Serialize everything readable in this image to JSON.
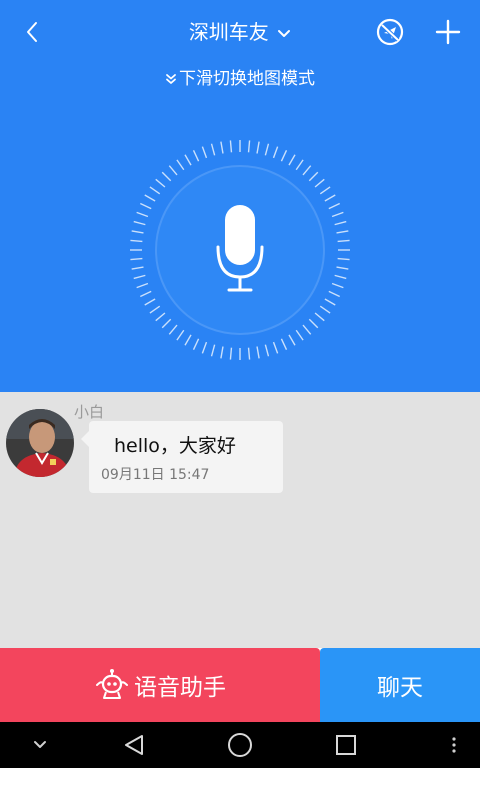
{
  "header": {
    "title": "深圳车友",
    "hint": "下滑切换地图模式"
  },
  "icons": {
    "back": "chevron-left-icon",
    "title_dropdown": "chevron-down-icon",
    "no_location": "location-off-icon",
    "add": "plus-icon",
    "mic": "microphone-icon",
    "robot": "robot-icon"
  },
  "chat": {
    "messages": [
      {
        "sender": "小白",
        "text": "hello，大家好",
        "time": "09月11日  15:47"
      }
    ]
  },
  "bottom": {
    "assistant_label": "语音助手",
    "chat_label": "聊天"
  },
  "colors": {
    "panel_blue": "#2a83f4",
    "assistant_red": "#f3455d",
    "chat_blue": "#2a95f7",
    "chat_bg": "#e2e2e2"
  }
}
